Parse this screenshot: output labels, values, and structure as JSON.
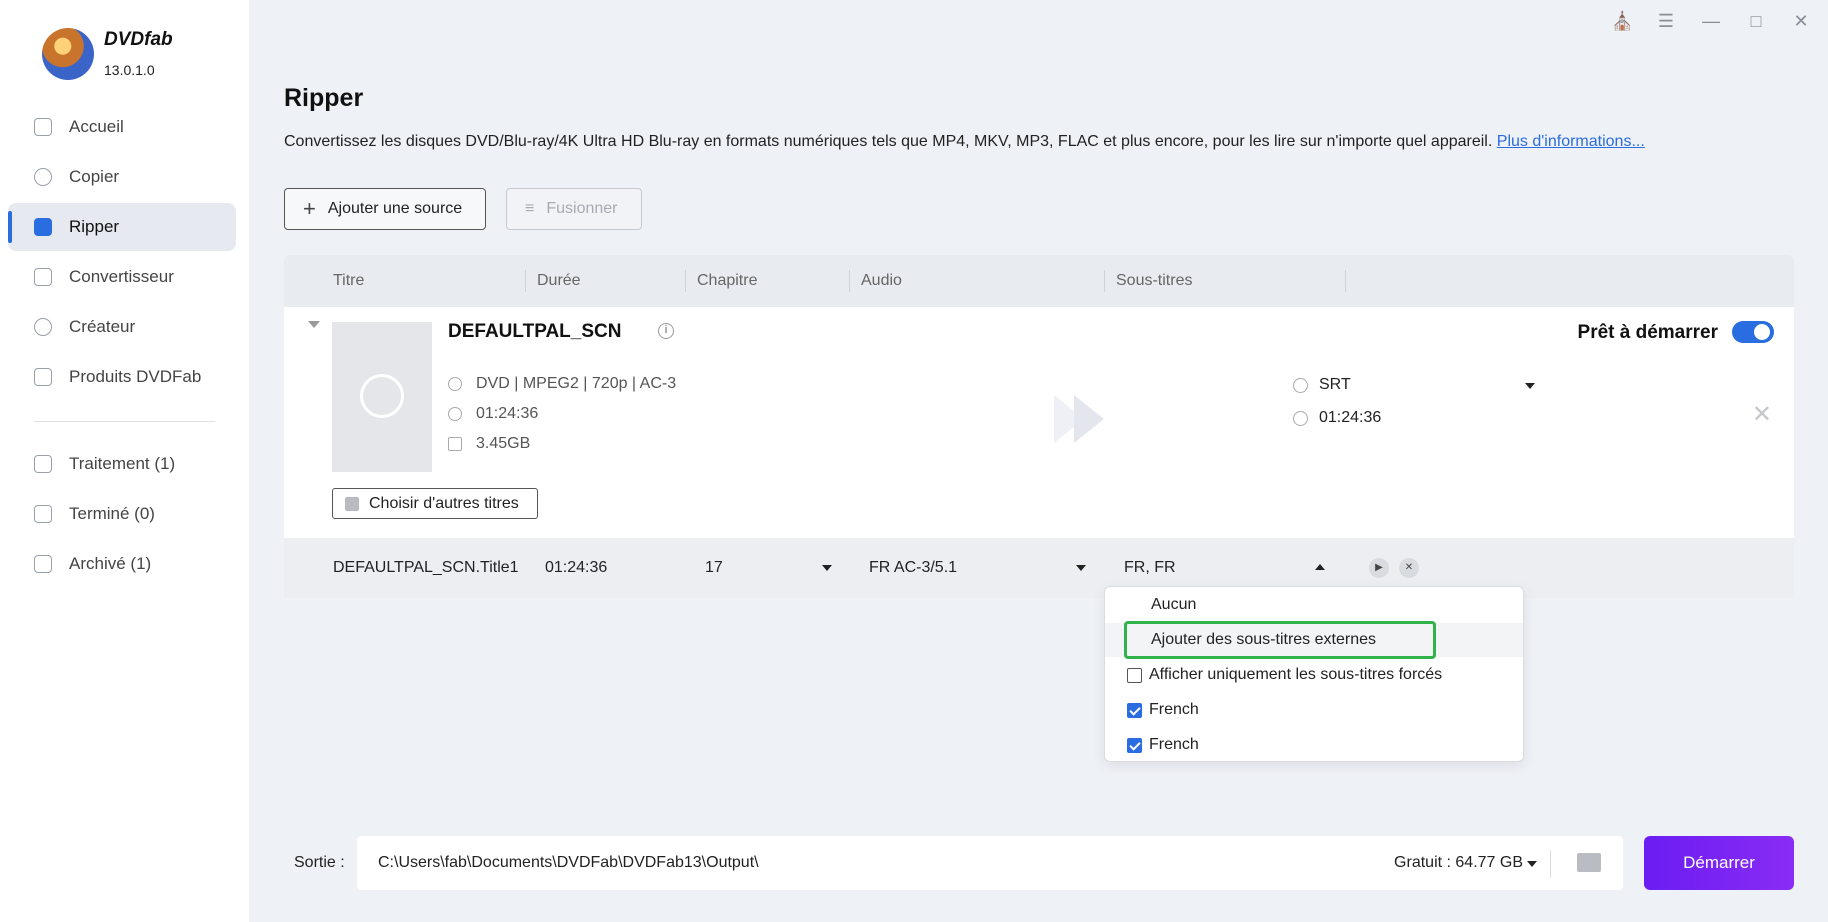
{
  "app": {
    "brand": "DVDfab",
    "version": "13.0.1.0"
  },
  "sidebar": {
    "items": [
      {
        "label": "Accueil"
      },
      {
        "label": "Copier"
      },
      {
        "label": "Ripper"
      },
      {
        "label": "Convertisseur"
      },
      {
        "label": "Créateur"
      },
      {
        "label": "Produits DVDFab"
      }
    ],
    "tasks": [
      {
        "label": "Traitement (1)"
      },
      {
        "label": "Terminé (0)"
      },
      {
        "label": "Archivé (1)"
      }
    ]
  },
  "page": {
    "title": "Ripper",
    "description": "Convertissez les disques DVD/Blu-ray/4K Ultra HD Blu-ray en formats numériques tels que MP4, MKV, MP3, FLAC et plus encore, pour les lire sur n'importe quel appareil.",
    "more_link": "Plus d'informations..."
  },
  "toolbar": {
    "add_source": "Ajouter une source",
    "merge": "Fusionner"
  },
  "table": {
    "headers": [
      "Titre",
      "Durée",
      "Chapitre",
      "Audio",
      "Sous-titres"
    ]
  },
  "source": {
    "title": "DEFAULTPAL_SCN",
    "format": "DVD | MPEG2 | 720p | AC-3",
    "duration": "01:24:36",
    "size": "3.45GB",
    "choose_titles": "Choisir d'autres titres",
    "status": "Prêt à démarrer",
    "output_format": "SRT",
    "output_duration": "01:24:36"
  },
  "title_row": {
    "name": "DEFAULTPAL_SCN.Title1",
    "duration": "01:24:36",
    "chapter": "17",
    "audio": "FR  AC-3/5.1",
    "subtitles": "FR, FR"
  },
  "subtitle_dropdown": {
    "items": [
      {
        "label": "Aucun"
      },
      {
        "label": "Ajouter des sous-titres externes"
      },
      {
        "label": "Afficher uniquement les sous-titres forcés",
        "checked": false
      },
      {
        "label": "French",
        "checked": true
      },
      {
        "label": "French",
        "checked": true
      }
    ]
  },
  "footer": {
    "output_label": "Sortie :",
    "output_path": "C:\\Users\\fab\\Documents\\DVDFab\\DVDFab13\\Output\\",
    "free_space": "Gratuit : 64.77 GB",
    "start": "Démarrer"
  },
  "colors": {
    "accent": "#2a6de0",
    "start": "#7b25f4",
    "highlight": "#2fb34a"
  }
}
